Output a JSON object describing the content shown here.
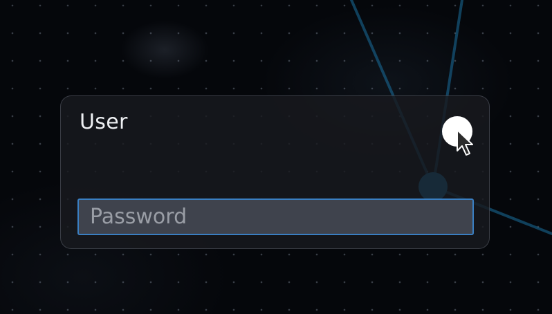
{
  "login": {
    "username": "User",
    "password_placeholder": "Password",
    "password_value": ""
  },
  "icons": {
    "avatar": "user-avatar-icon",
    "pointer": "mouse-pointer-icon"
  },
  "colors": {
    "background": "#05070b",
    "accent": "#1a7ab0",
    "field_border": "#3a7fc2",
    "field_background": "#3f434d",
    "text": "#eef0f3"
  }
}
